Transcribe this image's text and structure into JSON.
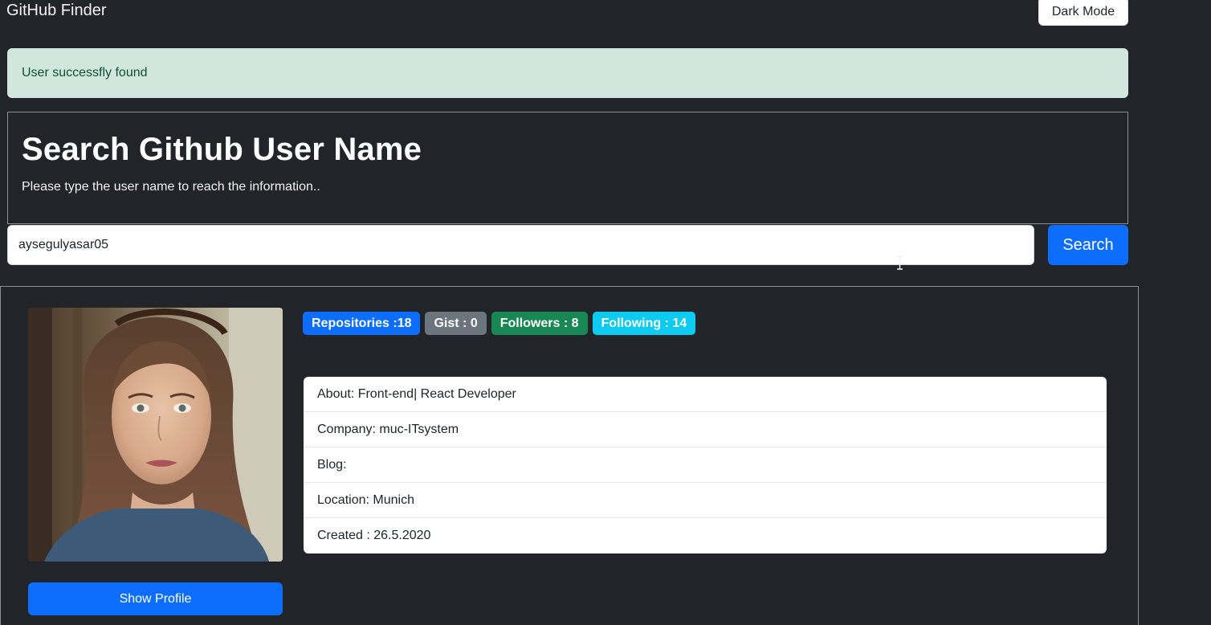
{
  "navbar": {
    "brand": "GitHub Finder",
    "dark_mode_label": "Dark Mode"
  },
  "alert": {
    "message": "User successfly found",
    "type": "success"
  },
  "search": {
    "title": "Search Github User Name",
    "subtitle": "Please type the user name to reach the information..",
    "input_value": "aysegulyasar05",
    "button_label": "Search"
  },
  "profile": {
    "show_profile_label": "Show Profile",
    "badges": [
      {
        "label": "Repositories :18",
        "color": "#0d6efd"
      },
      {
        "label": "Gist : 0",
        "color": "#6c757d"
      },
      {
        "label": "Followers : 8",
        "color": "#198754"
      },
      {
        "label": "Following : 14",
        "color": "#0dcaf0"
      }
    ],
    "details": [
      "About: Front-end| React Developer",
      "Company: muc-ITsystem",
      "Blog:",
      "Location: Munich",
      "Created : 26.5.2020"
    ]
  },
  "colors": {
    "background": "#212529",
    "primary": "#0d6efd",
    "alert_bg": "#d1e7dd"
  }
}
